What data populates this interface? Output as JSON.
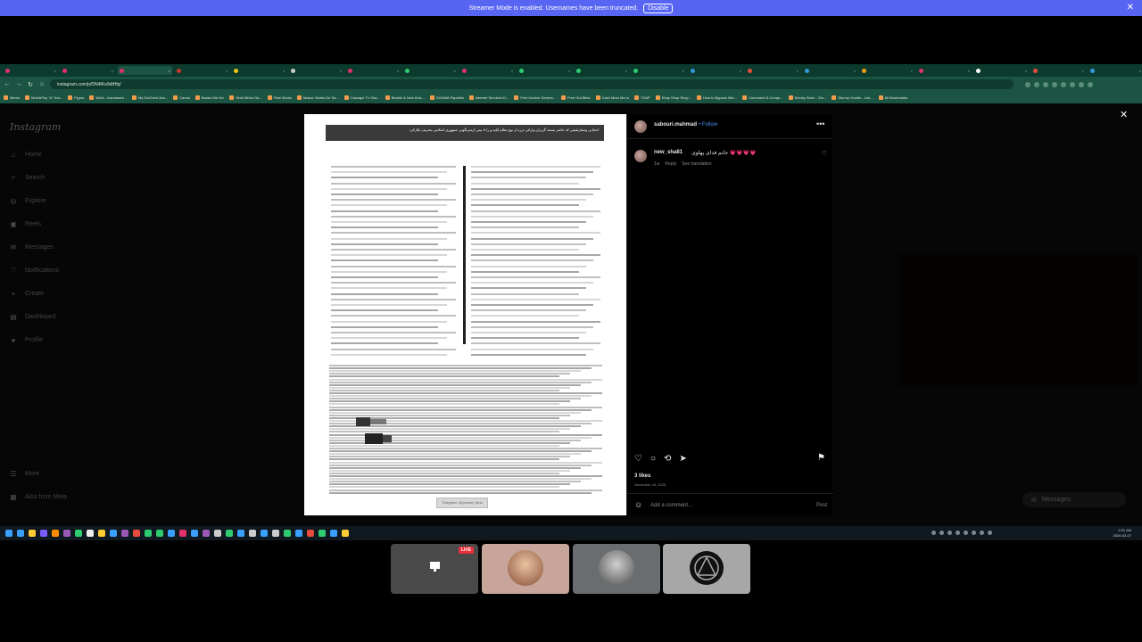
{
  "streamer_banner": {
    "message": "Streamer Mode is enabled. Usernames have been truncated.",
    "disable_label": "Disable",
    "close_glyph": "✕",
    "color": "#5865f2"
  },
  "browser": {
    "url": "instagram.com/p/DN4tKo9dtHbj/",
    "tab_colors": [
      "#e1306c",
      "#e1306c",
      "#e1306c",
      "#c0392b",
      "#f1c40f",
      "#cccccc",
      "#e1306c",
      "#2ecc71",
      "#e1306c",
      "#2ecc71",
      "#2ecc71",
      "#2ecc71",
      "#3498db",
      "#e74c3c",
      "#3498db",
      "#f39c12",
      "#e1306c",
      "#ffffff",
      "#e74c3c",
      "#3498db"
    ],
    "bookmarks": [
      "Meme",
      "MobileToy \"A\" Kar...",
      "Figma",
      "Work - Ivanmsant...",
      "My DaCherri Acc...",
      "Canva",
      "Bauko Ma Ver",
      "Yeah Mirka Ga...",
      "Feat Works",
      "Mascir Works De Sa...",
      "Cascape Tv Sha...",
      "Beadle & New Acts...",
      "DOAMA Papeiles",
      "Internet Services D...",
      "Free Invoice Genera...",
      "Free Out Blew",
      "Cash Mesr Ma In",
      "THAP",
      "Ebay Shop Shop...",
      "How to Bypass Win...",
      "Command & Conqu...",
      "Wonky Store - Sto...",
      "Stormy Vondie - Lim...",
      "All Bookmarks"
    ]
  },
  "instagram": {
    "logo": "Instagram",
    "nav": [
      {
        "name": "home",
        "label": "Home",
        "icon": "⌂"
      },
      {
        "name": "search",
        "label": "Search",
        "icon": "⌕"
      },
      {
        "name": "explore",
        "label": "Explore",
        "icon": "◎"
      },
      {
        "name": "reels",
        "label": "Reels",
        "icon": "▣"
      },
      {
        "name": "messages",
        "label": "Messages",
        "icon": "✉"
      },
      {
        "name": "notifications",
        "label": "Notifications",
        "icon": "♡"
      },
      {
        "name": "create",
        "label": "Create",
        "icon": "+"
      },
      {
        "name": "dashboard",
        "label": "Dashboard",
        "icon": "▤"
      },
      {
        "name": "profile",
        "label": "Profile",
        "icon": "●"
      }
    ],
    "nav_bottom": [
      {
        "name": "more",
        "label": "More",
        "icon": "☰"
      },
      {
        "name": "also-from-meta",
        "label": "Also from Meta",
        "icon": "▦"
      }
    ],
    "close_glyph": "✕",
    "messages_label": "Messages"
  },
  "post": {
    "username": "sabouri.mahmad",
    "follow_label": "• Follow",
    "more_glyph": "•••",
    "comment": {
      "username": "new_sha81",
      "text": "جانم فدای پهلوی 💗💗💗💗",
      "time": "1w",
      "reply": "Reply",
      "translation": "See translation"
    },
    "likes": "3 likes",
    "date": "December 26, 2025",
    "add_comment_placeholder": "Add a comment…",
    "post_label": "Post",
    "document": {
      "header_text": "انتخابی وستارتقیقی که حاضر نیستد گریزان وارائی ترزه از نوع تظام آیلیه و را تا بینی ارسرنگونی جمهوری اسلامی بتحریف بکارکرد",
      "footer_tag": "Telegram: @pahlavi_farsi"
    }
  },
  "taskbar": {
    "time": "2:31 AM",
    "date_text": "2026-02-07",
    "icon_colors": [
      "#3aa0ff",
      "#3aa0ff",
      "#ffcc33",
      "#7a5cff",
      "#ff8c00",
      "#9b59b6",
      "#2ecc71",
      "#eeeeee",
      "#ffcc33",
      "#3aa0ff",
      "#9b59b6",
      "#e74c3c",
      "#2ecc71",
      "#2ecc71",
      "#3aa0ff",
      "#e1306c",
      "#3aa0ff",
      "#9b59b6",
      "#cccccc",
      "#2ecc71",
      "#3aa0ff",
      "#cccccc",
      "#3aa0ff",
      "#cccccc",
      "#2ecc71",
      "#3aa0ff",
      "#e74c3c",
      "#2ecc71",
      "#3aa0ff",
      "#ffcc33"
    ]
  },
  "participants": {
    "live_label": "LIVE"
  }
}
